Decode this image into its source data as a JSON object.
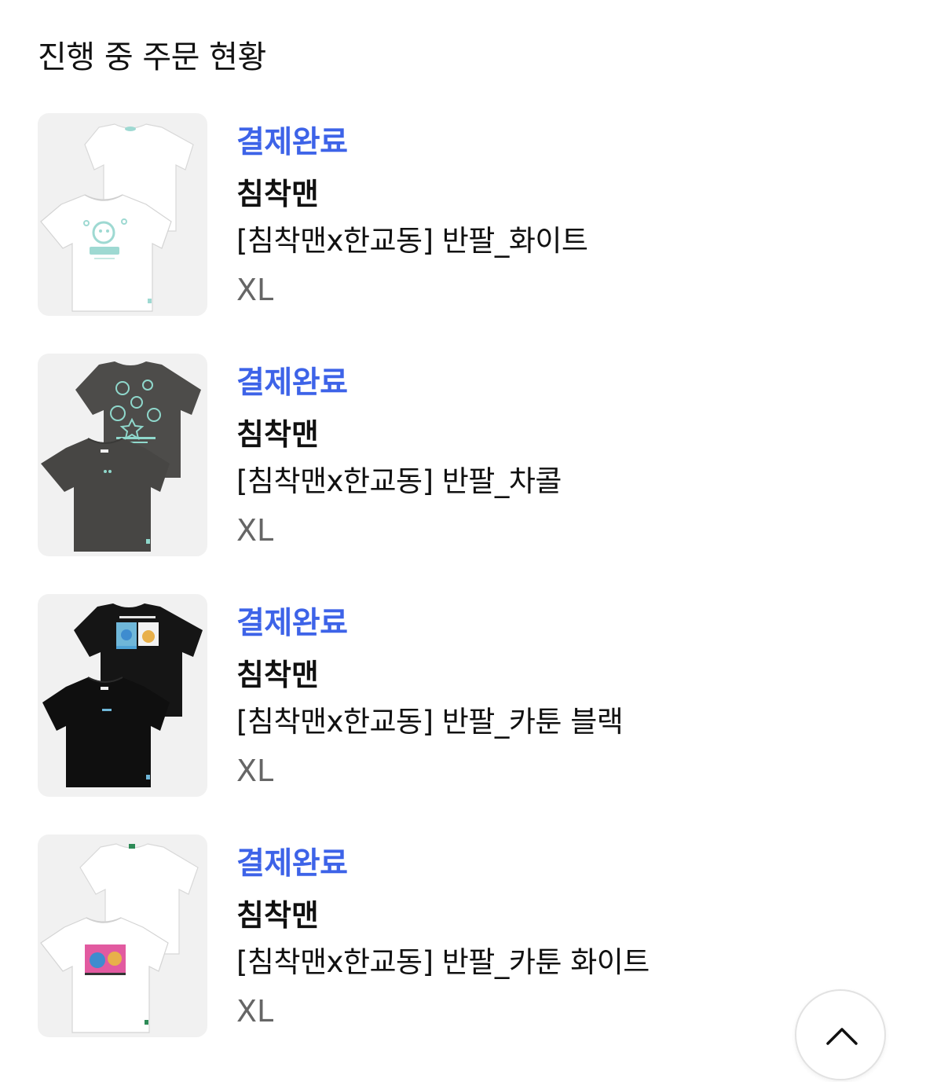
{
  "section_title": "진행 중 주문 현황",
  "orders": [
    {
      "status": "결제완료",
      "brand": "침착맨",
      "product": "[침착맨x한교동] 반팔_화이트",
      "option": "XL",
      "thumb_icon": "white-tshirt-image",
      "shirt_color": "#ffffff",
      "print_color": "#9ed9d2"
    },
    {
      "status": "결제완료",
      "brand": "침착맨",
      "product": "[침착맨x한교동] 반팔_차콜",
      "option": "XL",
      "thumb_icon": "charcoal-tshirt-image",
      "shirt_color": "#4a4a48",
      "print_color": "#8fd8cc"
    },
    {
      "status": "결제완료",
      "brand": "침착맨",
      "product": "[침착맨x한교동] 반팔_카툰 블랙",
      "option": "XL",
      "thumb_icon": "black-cartoon-tshirt-image",
      "shirt_color": "#141414",
      "print_color": "#6fb7d9"
    },
    {
      "status": "결제완료",
      "brand": "침착맨",
      "product": "[침착맨x한교동] 반팔_카툰 화이트",
      "option": "XL",
      "thumb_icon": "white-cartoon-tshirt-image",
      "shirt_color": "#ffffff",
      "print_color": "#e25aa0"
    }
  ],
  "scroll_top_icon": "chevron-up-icon",
  "colors": {
    "status": "#3d63e8",
    "text": "#111111",
    "option": "#666666",
    "thumb_bg": "#f1f1f1"
  }
}
